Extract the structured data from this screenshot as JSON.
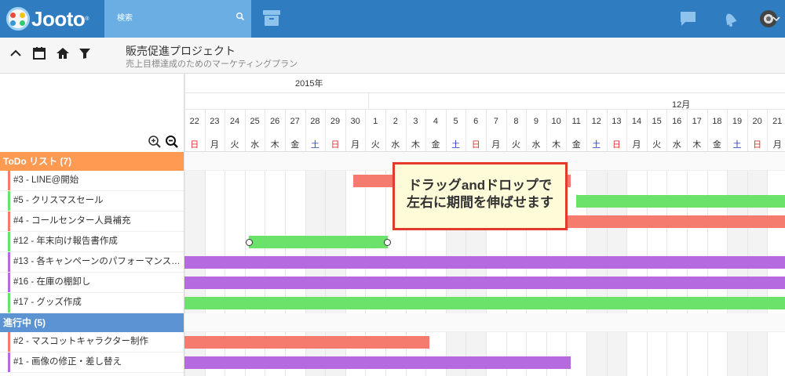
{
  "app": {
    "logo_text": "Jooto",
    "logo_tm": "®",
    "search_placeholder": "検索"
  },
  "project": {
    "title": "販売促進プロジェクト",
    "subtitle": "売上目標達成のためのマーケティングプラン"
  },
  "timeline": {
    "year_label": "2015年",
    "month_label": "12月",
    "days": [
      {
        "num": "22",
        "wd": "日",
        "type": "sun"
      },
      {
        "num": "23",
        "wd": "月",
        "type": "wk"
      },
      {
        "num": "24",
        "wd": "火",
        "type": "wk"
      },
      {
        "num": "25",
        "wd": "水",
        "type": "wk"
      },
      {
        "num": "26",
        "wd": "木",
        "type": "wk"
      },
      {
        "num": "27",
        "wd": "金",
        "type": "wk"
      },
      {
        "num": "28",
        "wd": "土",
        "type": "sat"
      },
      {
        "num": "29",
        "wd": "日",
        "type": "sun"
      },
      {
        "num": "30",
        "wd": "月",
        "type": "wk"
      },
      {
        "num": "1",
        "wd": "火",
        "type": "wk"
      },
      {
        "num": "2",
        "wd": "水",
        "type": "wk"
      },
      {
        "num": "3",
        "wd": "木",
        "type": "wk"
      },
      {
        "num": "4",
        "wd": "金",
        "type": "wk"
      },
      {
        "num": "5",
        "wd": "土",
        "type": "sat"
      },
      {
        "num": "6",
        "wd": "日",
        "type": "sun"
      },
      {
        "num": "7",
        "wd": "月",
        "type": "wk"
      },
      {
        "num": "8",
        "wd": "火",
        "type": "wk"
      },
      {
        "num": "9",
        "wd": "水",
        "type": "wk"
      },
      {
        "num": "10",
        "wd": "木",
        "type": "wk"
      },
      {
        "num": "11",
        "wd": "金",
        "type": "wk"
      },
      {
        "num": "12",
        "wd": "土",
        "type": "sat"
      },
      {
        "num": "13",
        "wd": "日",
        "type": "sun"
      },
      {
        "num": "14",
        "wd": "月",
        "type": "wk"
      },
      {
        "num": "15",
        "wd": "火",
        "type": "wk"
      },
      {
        "num": "16",
        "wd": "水",
        "type": "wk"
      },
      {
        "num": "17",
        "wd": "木",
        "type": "wk"
      },
      {
        "num": "18",
        "wd": "金",
        "type": "wk"
      },
      {
        "num": "19",
        "wd": "土",
        "type": "sat"
      },
      {
        "num": "20",
        "wd": "日",
        "type": "sun"
      },
      {
        "num": "21",
        "wd": "月",
        "type": "wk"
      }
    ]
  },
  "groups": [
    {
      "label": "ToDo リスト (7)",
      "color": "#ff9a52",
      "tasks": [
        {
          "label": "#3 - LINE@開始",
          "color": "#f47b6e",
          "start": 8.4,
          "end": 19.2
        },
        {
          "label": "#5 - クリスマスセール",
          "color": "#6be36b",
          "start": 19.5,
          "end": 30
        },
        {
          "label": "#4 - コールセンター人員補充",
          "color": "#f47b6e",
          "start": 18.5,
          "end": 30
        },
        {
          "label": "#12 - 年末向け報告書作成",
          "color": "#6be36b",
          "start": 3.2,
          "end": 10.1,
          "selected": true
        },
        {
          "label": "#13 - 各キャンペーンのパフォーマンス…",
          "color": "#b56ae0",
          "start": 0,
          "end": 30
        },
        {
          "label": "#16 - 在庫の棚卸し",
          "color": "#b56ae0",
          "start": 0,
          "end": 30
        },
        {
          "label": "#17 - グッズ作成",
          "color": "#6be36b",
          "start": 0,
          "end": 30
        }
      ]
    },
    {
      "label": "進行中 (5)",
      "color": "#5b93d3",
      "tasks": [
        {
          "label": "#2 - マスコットキャラクター制作",
          "color": "#f47b6e",
          "start": 0,
          "end": 12.2
        },
        {
          "label": "#1 - 画像の修正・差し替え",
          "color": "#b56ae0",
          "start": 0,
          "end": 19.2
        }
      ]
    }
  ],
  "tooltip": {
    "line1": "ドラッグandドロップで",
    "line2": "左右に期間を伸ばせます"
  },
  "colors": {
    "header": "#2f7dc0",
    "search": "#6aaee3",
    "sunday": "#e03030",
    "saturday": "#2236c4"
  }
}
